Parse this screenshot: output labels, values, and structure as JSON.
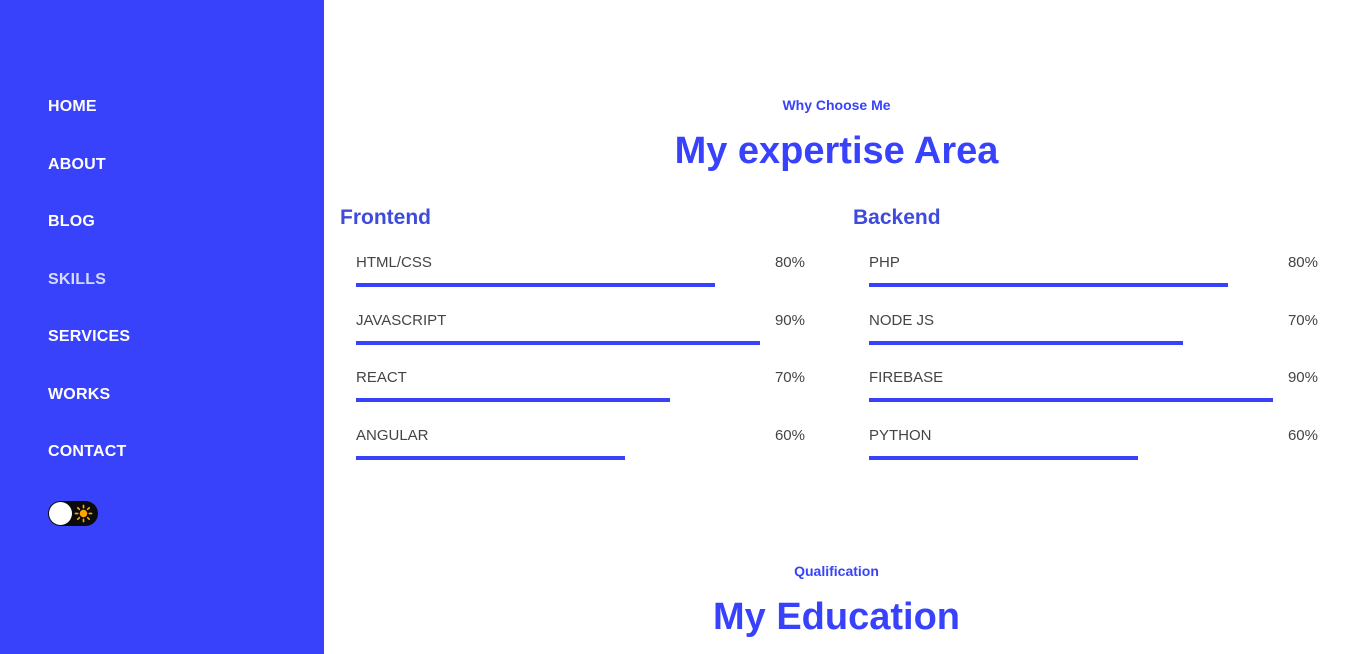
{
  "nav": {
    "items": [
      {
        "label": "HOME",
        "active": false
      },
      {
        "label": "ABOUT",
        "active": false
      },
      {
        "label": "BLOG",
        "active": false
      },
      {
        "label": "SKILLS",
        "active": true
      },
      {
        "label": "SERVICES",
        "active": false
      },
      {
        "label": "WORKS",
        "active": false
      },
      {
        "label": "CONTACT",
        "active": false
      }
    ],
    "theme_toggle": {
      "state": "light",
      "icon": "sun-icon"
    }
  },
  "expertise": {
    "eyebrow": "Why Choose Me",
    "title": "My expertise Area",
    "columns": [
      {
        "title": "Frontend",
        "skills": [
          {
            "name": "HTML/CSS",
            "percent_label": "80%",
            "value": 80
          },
          {
            "name": "JAVASCRIPT",
            "percent_label": "90%",
            "value": 90
          },
          {
            "name": "REACT",
            "percent_label": "70%",
            "value": 70
          },
          {
            "name": "ANGULAR",
            "percent_label": "60%",
            "value": 60
          }
        ]
      },
      {
        "title": "Backend",
        "skills": [
          {
            "name": "PHP",
            "percent_label": "80%",
            "value": 80
          },
          {
            "name": "NODE JS",
            "percent_label": "70%",
            "value": 70
          },
          {
            "name": "FIREBASE",
            "percent_label": "90%",
            "value": 90
          },
          {
            "name": "PYTHON",
            "percent_label": "60%",
            "value": 60
          }
        ]
      }
    ]
  },
  "education": {
    "eyebrow": "Qualification",
    "title": "My Education"
  },
  "colors": {
    "accent": "#3742fa",
    "sidebar": "#3742fa",
    "text": "#444444"
  }
}
